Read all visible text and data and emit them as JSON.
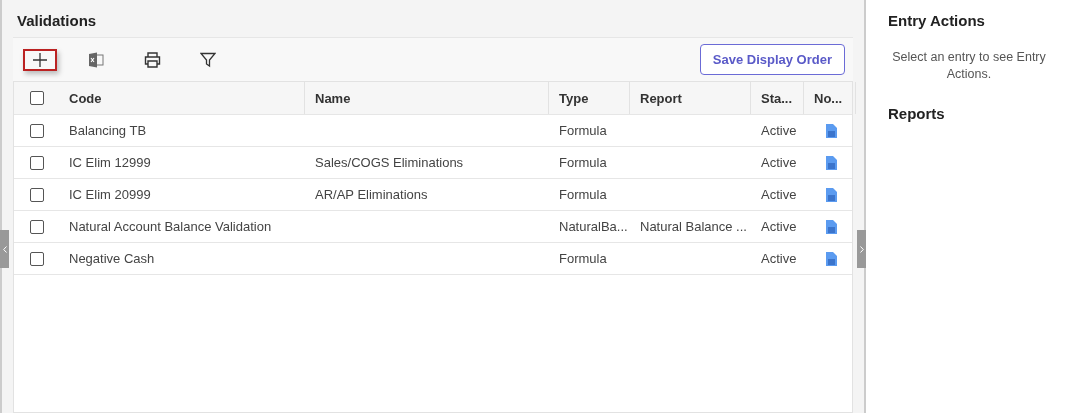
{
  "main": {
    "title": "Validations",
    "toolbar": [
      {
        "kind": "add",
        "focused": true
      },
      {
        "kind": "export",
        "focused": false
      },
      {
        "kind": "print",
        "focused": false
      },
      {
        "kind": "filter",
        "focused": false
      }
    ],
    "save_button": "Save Display Order",
    "table": {
      "select_all": {
        "checked": false
      },
      "columns": [
        "Code",
        "Name",
        "Type",
        "Report",
        "Sta...",
        "No..."
      ],
      "rows": [
        {
          "checked": false,
          "cells": [
            "Balancing TB",
            "",
            "Formula",
            "",
            "Active"
          ],
          "has_note": true
        },
        {
          "checked": false,
          "cells": [
            "IC Elim 12999",
            "Sales/COGS Eliminations",
            "Formula",
            "",
            "Active"
          ],
          "has_note": true
        },
        {
          "checked": false,
          "cells": [
            "IC Elim 20999",
            "AR/AP Eliminations",
            "Formula",
            "",
            "Active"
          ],
          "has_note": true
        },
        {
          "checked": false,
          "cells": [
            "Natural Account Balance Validation",
            "",
            "NaturalBa...",
            "Natural Balance ...",
            "Active"
          ],
          "has_note": true
        },
        {
          "checked": false,
          "cells": [
            "Negative Cash",
            "",
            "Formula",
            "",
            "Active"
          ],
          "has_note": true
        }
      ]
    }
  },
  "side": {
    "entry_title": "Entry Actions",
    "entry_hint": "Select an entry to see Entry Actions.",
    "reports_title": "Reports"
  }
}
